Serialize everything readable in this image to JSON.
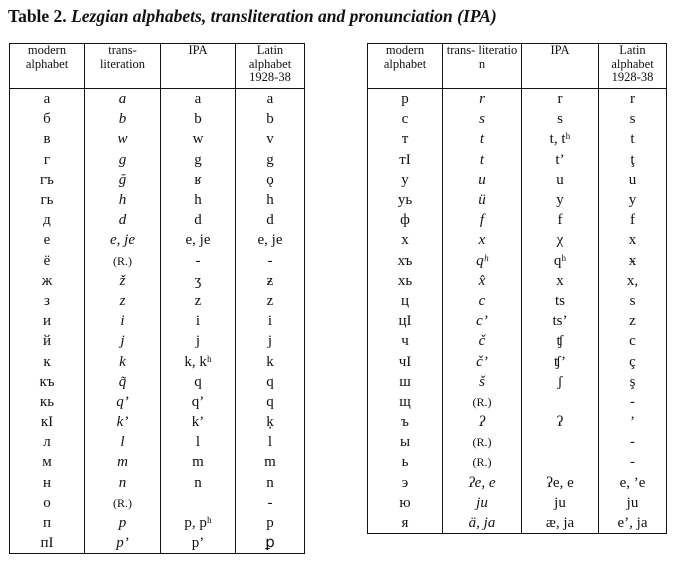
{
  "caption": {
    "number": "Table 2.",
    "title": "Lezgian alphabets, transliteration and pronunciation (IPA)"
  },
  "headers": {
    "modern": "modern alphabet",
    "translit_left": "trans- literation",
    "translit_right": "trans- literatio n",
    "ipa": "IPA",
    "latin": "Latin alphabet 1928-38"
  },
  "left_rows": [
    [
      "а",
      "a",
      "a",
      "a"
    ],
    [
      "б",
      "b",
      "b",
      "b"
    ],
    [
      "в",
      "w",
      "w",
      "v"
    ],
    [
      "г",
      "g",
      "g",
      "g"
    ],
    [
      "гъ",
      "ğ",
      "ʁ",
      "ǫ"
    ],
    [
      "гь",
      "h",
      "h",
      "h"
    ],
    [
      "д",
      "d",
      "d",
      "d"
    ],
    [
      "е",
      "e, je",
      "e, je",
      "e, je"
    ],
    [
      "ё",
      "(R.)",
      "-",
      "-"
    ],
    [
      "ж",
      "ž",
      "ʒ",
      "ƶ"
    ],
    [
      "з",
      "z",
      "z",
      "z"
    ],
    [
      "и",
      "i",
      "i",
      "i"
    ],
    [
      "й",
      "j",
      "j",
      "j"
    ],
    [
      "к",
      "k",
      "k, kʰ",
      "k"
    ],
    [
      "къ",
      "q̃",
      "q",
      "q"
    ],
    [
      "кь",
      "q’",
      "q’",
      "q"
    ],
    [
      "кI",
      "k’",
      "k’",
      "ķ"
    ],
    [
      "л",
      "l",
      "l",
      "l"
    ],
    [
      "м",
      "m",
      "m",
      "m"
    ],
    [
      "н",
      "n",
      "n",
      "n"
    ],
    [
      "о",
      "(R.)",
      "",
      "-"
    ],
    [
      "п",
      "p",
      "p, pʰ",
      "p"
    ],
    [
      "пI",
      "p’",
      "p’",
      "ꝑ"
    ]
  ],
  "right_rows": [
    [
      "р",
      "r",
      "r",
      "r"
    ],
    [
      "с",
      "s",
      "s",
      "s"
    ],
    [
      "т",
      "t",
      "t, tʰ",
      "t"
    ],
    [
      "тI",
      "t",
      "t’",
      "ţ"
    ],
    [
      "у",
      "u",
      "u",
      "u"
    ],
    [
      "уь",
      "ü",
      "y",
      "y"
    ],
    [
      "ф",
      "f",
      "f",
      "f"
    ],
    [
      "х",
      "x",
      "χ",
      "x"
    ],
    [
      "хъ",
      "qʰ",
      "qʰ",
      "ӿ"
    ],
    [
      "хь",
      "x̂",
      "x",
      "x,"
    ],
    [
      "ц",
      "c",
      "ts",
      "s"
    ],
    [
      "цI",
      "c’",
      "ts’",
      "z"
    ],
    [
      "ч",
      "č",
      "ʧ",
      "c"
    ],
    [
      "чI",
      "č’",
      "ʧ’",
      "ç"
    ],
    [
      "ш",
      "š",
      "ʃ",
      "ş"
    ],
    [
      "щ",
      "(R.)",
      "",
      "-"
    ],
    [
      "ъ",
      "ʔ",
      "ʔ",
      "’"
    ],
    [
      "ы",
      "(R.)",
      "",
      "-"
    ],
    [
      "ь",
      "(R.)",
      "",
      "-"
    ],
    [
      "э",
      "ʔe, e",
      "ʔe, e",
      "e, ’e"
    ],
    [
      "ю",
      "ju",
      "ju",
      "ju"
    ],
    [
      "я",
      "ä, ja",
      "æ, ja",
      "e’, ja"
    ]
  ]
}
